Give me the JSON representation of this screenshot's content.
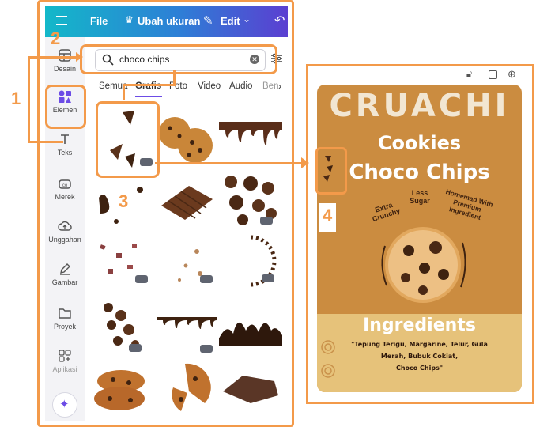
{
  "topbar": {
    "menu_icon": "hamburger-icon",
    "file_label": "File",
    "resize_label": "Ubah ukuran",
    "edit_label": "Edit",
    "brand_color": "#2d7fd6"
  },
  "rail": {
    "items": [
      {
        "label": "Desain",
        "icon": "layout-icon"
      },
      {
        "label": "Elemen",
        "icon": "shapes-icon",
        "active": true
      },
      {
        "label": "Teks",
        "icon": "text-icon"
      },
      {
        "label": "Merek",
        "icon": "brand-icon"
      },
      {
        "label": "Unggahan",
        "icon": "cloud-upload-icon"
      },
      {
        "label": "Gambar",
        "icon": "pen-icon"
      },
      {
        "label": "Proyek",
        "icon": "folder-icon"
      },
      {
        "label": "Aplikasi",
        "icon": "apps-icon"
      }
    ]
  },
  "search": {
    "value": "choco chips"
  },
  "tabs": {
    "items": [
      "Semua",
      "Grafis",
      "Foto",
      "Video",
      "Audio",
      "Ben"
    ],
    "active": "Grafis"
  },
  "annotations": {
    "n1": "1",
    "n2": "2",
    "n3": "3",
    "n4": "4",
    "color": "#f39a4a"
  },
  "poster": {
    "brand": "CRUACHI",
    "title1": "Cookies",
    "title2": "Choco Chips",
    "callout1": "Extra Crunchy",
    "callout2": "Less Sugar",
    "callout3": "Homemad With Premium Ingredient",
    "ingredients_title": "Ingredients",
    "ingredients_line1": "\"Tepung Terigu, Margarine, Telur, Gula",
    "ingredients_line2": "Merah, Bubuk Cokiat,",
    "ingredients_line3": "Choco Chips\""
  }
}
